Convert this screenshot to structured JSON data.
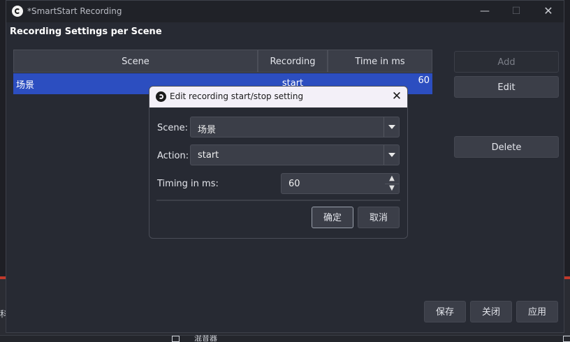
{
  "background": {
    "left_text": "科",
    "bottom_text": "混音器"
  },
  "window": {
    "title": "*SmartStart Recording",
    "heading": "Recording Settings per Scene",
    "controls": {
      "minimize": "—",
      "maximize": "☐",
      "close": "✕"
    }
  },
  "table": {
    "columns": [
      "Scene",
      "Recording",
      "Time in ms"
    ],
    "rows": [
      {
        "scene": "场景",
        "recording": "start",
        "time": "60"
      }
    ]
  },
  "side_buttons": {
    "add": "Add",
    "edit": "Edit",
    "delete": "Delete"
  },
  "bottom_buttons": {
    "save": "保存",
    "close": "关闭",
    "apply": "应用"
  },
  "dialog": {
    "title": "Edit recording start/stop setting",
    "close": "✕",
    "scene_label": "Scene:",
    "scene_value": "场景",
    "action_label": "Action:",
    "action_value": "start",
    "timing_label": "Timing in ms:",
    "timing_value": "60",
    "ok": "确定",
    "cancel": "取消"
  },
  "colors": {
    "selection": "#2c4ec0",
    "window_bg": "#272a33",
    "button_bg": "#3b3e48",
    "dialog_titlebar": "#f3f0f8"
  }
}
